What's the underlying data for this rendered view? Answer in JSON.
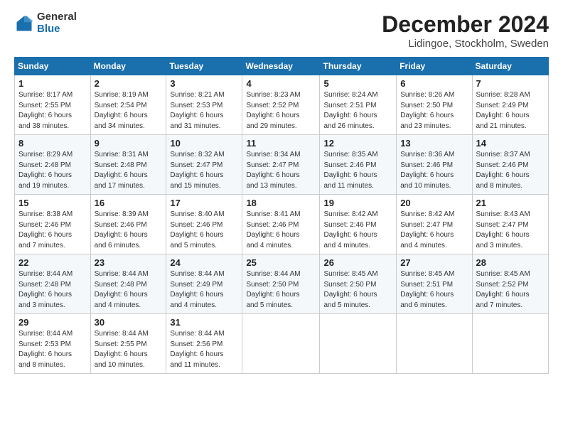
{
  "logo": {
    "general": "General",
    "blue": "Blue"
  },
  "header": {
    "month": "December 2024",
    "location": "Lidingoe, Stockholm, Sweden"
  },
  "days_of_week": [
    "Sunday",
    "Monday",
    "Tuesday",
    "Wednesday",
    "Thursday",
    "Friday",
    "Saturday"
  ],
  "weeks": [
    [
      {
        "day": "1",
        "info": "Sunrise: 8:17 AM\nSunset: 2:55 PM\nDaylight: 6 hours\nand 38 minutes."
      },
      {
        "day": "2",
        "info": "Sunrise: 8:19 AM\nSunset: 2:54 PM\nDaylight: 6 hours\nand 34 minutes."
      },
      {
        "day": "3",
        "info": "Sunrise: 8:21 AM\nSunset: 2:53 PM\nDaylight: 6 hours\nand 31 minutes."
      },
      {
        "day": "4",
        "info": "Sunrise: 8:23 AM\nSunset: 2:52 PM\nDaylight: 6 hours\nand 29 minutes."
      },
      {
        "day": "5",
        "info": "Sunrise: 8:24 AM\nSunset: 2:51 PM\nDaylight: 6 hours\nand 26 minutes."
      },
      {
        "day": "6",
        "info": "Sunrise: 8:26 AM\nSunset: 2:50 PM\nDaylight: 6 hours\nand 23 minutes."
      },
      {
        "day": "7",
        "info": "Sunrise: 8:28 AM\nSunset: 2:49 PM\nDaylight: 6 hours\nand 21 minutes."
      }
    ],
    [
      {
        "day": "8",
        "info": "Sunrise: 8:29 AM\nSunset: 2:48 PM\nDaylight: 6 hours\nand 19 minutes."
      },
      {
        "day": "9",
        "info": "Sunrise: 8:31 AM\nSunset: 2:48 PM\nDaylight: 6 hours\nand 17 minutes."
      },
      {
        "day": "10",
        "info": "Sunrise: 8:32 AM\nSunset: 2:47 PM\nDaylight: 6 hours\nand 15 minutes."
      },
      {
        "day": "11",
        "info": "Sunrise: 8:34 AM\nSunset: 2:47 PM\nDaylight: 6 hours\nand 13 minutes."
      },
      {
        "day": "12",
        "info": "Sunrise: 8:35 AM\nSunset: 2:46 PM\nDaylight: 6 hours\nand 11 minutes."
      },
      {
        "day": "13",
        "info": "Sunrise: 8:36 AM\nSunset: 2:46 PM\nDaylight: 6 hours\nand 10 minutes."
      },
      {
        "day": "14",
        "info": "Sunrise: 8:37 AM\nSunset: 2:46 PM\nDaylight: 6 hours\nand 8 minutes."
      }
    ],
    [
      {
        "day": "15",
        "info": "Sunrise: 8:38 AM\nSunset: 2:46 PM\nDaylight: 6 hours\nand 7 minutes."
      },
      {
        "day": "16",
        "info": "Sunrise: 8:39 AM\nSunset: 2:46 PM\nDaylight: 6 hours\nand 6 minutes."
      },
      {
        "day": "17",
        "info": "Sunrise: 8:40 AM\nSunset: 2:46 PM\nDaylight: 6 hours\nand 5 minutes."
      },
      {
        "day": "18",
        "info": "Sunrise: 8:41 AM\nSunset: 2:46 PM\nDaylight: 6 hours\nand 4 minutes."
      },
      {
        "day": "19",
        "info": "Sunrise: 8:42 AM\nSunset: 2:46 PM\nDaylight: 6 hours\nand 4 minutes."
      },
      {
        "day": "20",
        "info": "Sunrise: 8:42 AM\nSunset: 2:47 PM\nDaylight: 6 hours\nand 4 minutes."
      },
      {
        "day": "21",
        "info": "Sunrise: 8:43 AM\nSunset: 2:47 PM\nDaylight: 6 hours\nand 3 minutes."
      }
    ],
    [
      {
        "day": "22",
        "info": "Sunrise: 8:44 AM\nSunset: 2:48 PM\nDaylight: 6 hours\nand 3 minutes."
      },
      {
        "day": "23",
        "info": "Sunrise: 8:44 AM\nSunset: 2:48 PM\nDaylight: 6 hours\nand 4 minutes."
      },
      {
        "day": "24",
        "info": "Sunrise: 8:44 AM\nSunset: 2:49 PM\nDaylight: 6 hours\nand 4 minutes."
      },
      {
        "day": "25",
        "info": "Sunrise: 8:44 AM\nSunset: 2:50 PM\nDaylight: 6 hours\nand 5 minutes."
      },
      {
        "day": "26",
        "info": "Sunrise: 8:45 AM\nSunset: 2:50 PM\nDaylight: 6 hours\nand 5 minutes."
      },
      {
        "day": "27",
        "info": "Sunrise: 8:45 AM\nSunset: 2:51 PM\nDaylight: 6 hours\nand 6 minutes."
      },
      {
        "day": "28",
        "info": "Sunrise: 8:45 AM\nSunset: 2:52 PM\nDaylight: 6 hours\nand 7 minutes."
      }
    ],
    [
      {
        "day": "29",
        "info": "Sunrise: 8:44 AM\nSunset: 2:53 PM\nDaylight: 6 hours\nand 8 minutes."
      },
      {
        "day": "30",
        "info": "Sunrise: 8:44 AM\nSunset: 2:55 PM\nDaylight: 6 hours\nand 10 minutes."
      },
      {
        "day": "31",
        "info": "Sunrise: 8:44 AM\nSunset: 2:56 PM\nDaylight: 6 hours\nand 11 minutes."
      },
      null,
      null,
      null,
      null
    ]
  ]
}
